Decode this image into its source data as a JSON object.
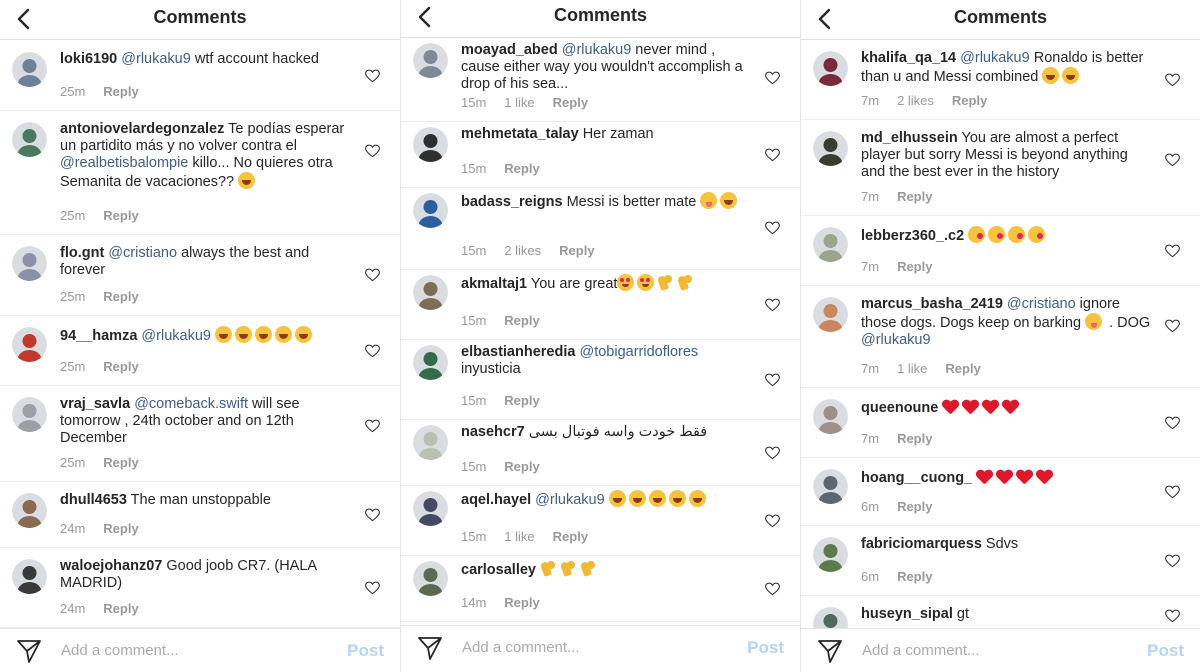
{
  "header": {
    "title": "Comments"
  },
  "footer": {
    "placeholder": "Add a comment...",
    "post_label": "Post"
  },
  "reply_label": "Reply",
  "panels": [
    {
      "comments": [
        {
          "user": "loki6190",
          "parts": [
            {
              "t": "mention",
              "v": "@rlukaku9"
            },
            {
              "t": "text",
              "v": " wtf account hacked"
            }
          ],
          "time": "25m",
          "likes": "",
          "avatar_color": "#6b8299"
        },
        {
          "user": "antoniovelardegonzalez",
          "parts": [
            {
              "t": "text",
              "v": " Te podías esperar un partidito más y no volver contra el "
            },
            {
              "t": "mention",
              "v": "@realbetisbalompie"
            },
            {
              "t": "text",
              "v": " killo... No quieres otra Semanita de vacaciones?? "
            },
            {
              "t": "emoji",
              "v": "laugh"
            }
          ],
          "time": "25m",
          "likes": "",
          "avatar_color": "#4a7a5c"
        },
        {
          "user": "flo.gnt",
          "parts": [
            {
              "t": "mention",
              "v": "@cristiano"
            },
            {
              "t": "text",
              "v": " always the best and forever"
            }
          ],
          "time": "25m",
          "likes": "",
          "avatar_color": "#8a90a8"
        },
        {
          "user": "94__hamza",
          "parts": [
            {
              "t": "mention",
              "v": "@rlukaku9"
            },
            {
              "t": "text",
              "v": " "
            },
            {
              "t": "emoji",
              "v": "laugh"
            },
            {
              "t": "emoji",
              "v": "laugh"
            },
            {
              "t": "emoji",
              "v": "laugh"
            },
            {
              "t": "emoji",
              "v": "laugh"
            },
            {
              "t": "emoji",
              "v": "laugh"
            }
          ],
          "time": "25m",
          "likes": "",
          "avatar_color": "#c0392b"
        },
        {
          "user": "vraj_savla",
          "parts": [
            {
              "t": "mention",
              "v": "@comeback.swift"
            },
            {
              "t": "text",
              "v": "  will see tomorrow , 24th october and on 12th December"
            }
          ],
          "time": "25m",
          "likes": "",
          "avatar_color": "#9aa0a6"
        },
        {
          "user": "dhull4653",
          "parts": [
            {
              "t": "text",
              "v": " The man unstoppable"
            }
          ],
          "time": "24m",
          "likes": "",
          "avatar_color": "#8b6a4f"
        },
        {
          "user": "waloejohanz07",
          "parts": [
            {
              "t": "text",
              "v": " Good joob CR7. (HALA MADRID)"
            }
          ],
          "time": "24m",
          "likes": "",
          "avatar_color": "#3a3a3a"
        }
      ]
    },
    {
      "comments": [
        {
          "user": "moayad_abed",
          "parts": [
            {
              "t": "mention",
              "v": "@rlukaku9"
            },
            {
              "t": "text",
              "v": " never mind , cause either way you wouldn't accomplish a drop of his sea..."
            }
          ],
          "time": "15m",
          "likes": "1 like",
          "avatar_color": "#7d8b96"
        },
        {
          "user": "mehmetata_talay",
          "parts": [
            {
              "t": "text",
              "v": " Her zaman"
            }
          ],
          "time": "15m",
          "likes": "",
          "avatar_color": "#2f2f2f"
        },
        {
          "user": "badass_reigns",
          "parts": [
            {
              "t": "text",
              "v": " Messi is better mate "
            },
            {
              "t": "emoji",
              "v": "tongue"
            },
            {
              "t": "emoji",
              "v": "laugh"
            }
          ],
          "time": "15m",
          "likes": "2 likes",
          "avatar_color": "#2c5fa0"
        },
        {
          "user": "akmaltaj1",
          "parts": [
            {
              "t": "text",
              "v": " You are great"
            },
            {
              "t": "emoji",
              "v": "heartEyes"
            },
            {
              "t": "emoji",
              "v": "heartEyes"
            },
            {
              "t": "emoji",
              "v": "muscle"
            },
            {
              "t": "emoji",
              "v": "muscle"
            }
          ],
          "time": "15m",
          "likes": "",
          "avatar_color": "#7a6e55"
        },
        {
          "user": "elbastianheredia",
          "parts": [
            {
              "t": "mention",
              "v": "@tobigarridoflores"
            },
            {
              "t": "text",
              "v": " inyusticia"
            }
          ],
          "time": "15m",
          "likes": "",
          "avatar_color": "#356b4a"
        },
        {
          "user": "nasehcr7",
          "parts": [
            {
              "t": "text",
              "v": " فقط خودت واسه فوتبال بسی"
            }
          ],
          "time": "15m",
          "likes": "",
          "avatar_color": "#b8c0b0"
        },
        {
          "user": "aqel.hayel",
          "parts": [
            {
              "t": "mention",
              "v": "@rlukaku9"
            },
            {
              "t": "text",
              "v": " "
            },
            {
              "t": "emoji",
              "v": "laugh"
            },
            {
              "t": "emoji",
              "v": "laugh"
            },
            {
              "t": "emoji",
              "v": "laugh"
            },
            {
              "t": "emoji",
              "v": "laugh"
            },
            {
              "t": "emoji",
              "v": "laugh"
            }
          ],
          "time": "15m",
          "likes": "1 like",
          "avatar_color": "#444a66"
        },
        {
          "user": "carlosalley",
          "parts": [
            {
              "t": "text",
              "v": " "
            },
            {
              "t": "emoji",
              "v": "muscle"
            },
            {
              "t": "emoji",
              "v": "muscle"
            },
            {
              "t": "emoji",
              "v": "muscle"
            }
          ],
          "time": "14m",
          "likes": "",
          "avatar_color": "#5a6b4e"
        }
      ]
    },
    {
      "comments": [
        {
          "user": "khalifa_qa_14",
          "parts": [
            {
              "t": "mention",
              "v": "@rlukaku9"
            },
            {
              "t": "text",
              "v": " Ronaldo is better than u and Messi combined "
            },
            {
              "t": "emoji",
              "v": "laugh"
            },
            {
              "t": "emoji",
              "v": "laugh"
            }
          ],
          "time": "7m",
          "likes": "2 likes",
          "avatar_color": "#7a2a3a"
        },
        {
          "user": "md_elhussein",
          "parts": [
            {
              "t": "text",
              "v": " You are almost a perfect player but sorry Messi is beyond anything and the best ever in the history"
            }
          ],
          "time": "7m",
          "likes": "",
          "avatar_color": "#3b3b2e"
        },
        {
          "user": "lebberz360_.c2",
          "parts": [
            {
              "t": "text",
              "v": " "
            },
            {
              "t": "emoji",
              "v": "kiss"
            },
            {
              "t": "emoji",
              "v": "kiss"
            },
            {
              "t": "emoji",
              "v": "kiss"
            },
            {
              "t": "emoji",
              "v": "kiss"
            }
          ],
          "time": "7m",
          "likes": "",
          "avatar_color": "#9aa58a"
        },
        {
          "user": "marcus_basha_2419",
          "parts": [
            {
              "t": "mention",
              "v": "@cristiano"
            },
            {
              "t": "text",
              "v": "  ignore those dogs. Dogs keep on barking "
            },
            {
              "t": "emoji",
              "v": "tongue"
            },
            {
              "t": "text",
              "v": " . DOG "
            },
            {
              "t": "mention",
              "v": "@rlukaku9"
            }
          ],
          "time": "7m",
          "likes": "1 like",
          "avatar_color": "#c9875f"
        },
        {
          "user": "queenoune",
          "parts": [
            {
              "t": "text",
              "v": " "
            },
            {
              "t": "emoji",
              "v": "redheart"
            },
            {
              "t": "emoji",
              "v": "redheart"
            },
            {
              "t": "emoji",
              "v": "redheart"
            },
            {
              "t": "emoji",
              "v": "redheart"
            }
          ],
          "time": "7m",
          "likes": "",
          "avatar_color": "#9f8f86"
        },
        {
          "user": "hoang__cuong_",
          "parts": [
            {
              "t": "text",
              "v": " "
            },
            {
              "t": "emoji",
              "v": "redheart"
            },
            {
              "t": "emoji",
              "v": "redheart"
            },
            {
              "t": "emoji",
              "v": "redheart"
            },
            {
              "t": "emoji",
              "v": "redheart"
            }
          ],
          "time": "6m",
          "likes": "",
          "avatar_color": "#5b6670"
        },
        {
          "user": "fabriciomarquess",
          "parts": [
            {
              "t": "text",
              "v": " Sdvs"
            }
          ],
          "time": "6m",
          "likes": "",
          "avatar_color": "#5d7a4b"
        },
        {
          "user": "huseyn_sipal",
          "parts": [
            {
              "t": "text",
              "v": " gt"
            }
          ],
          "time": "",
          "likes": "",
          "avatar_color": "#4f6a5a"
        }
      ]
    }
  ]
}
